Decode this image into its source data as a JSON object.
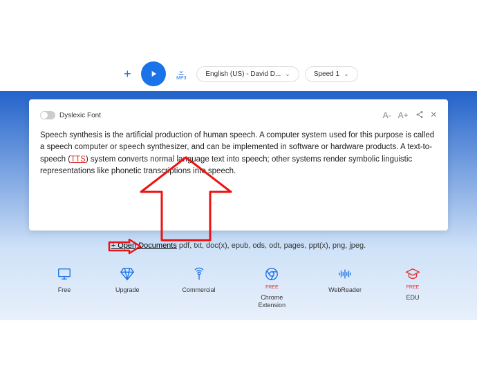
{
  "topbar": {
    "voice_selector": "English (US) - David D...",
    "speed_selector": "Speed 1",
    "mp3_label": "MP3"
  },
  "card": {
    "font_toggle_label": "Dyslexic Font",
    "font_dec": "A-",
    "font_inc": "A+",
    "share_label": "Share",
    "close_label": "×",
    "paragraph_pre": "Speech synthesis is the artificial production of human speech. A computer system used for this purpose is called a speech computer or speech synthesizer, and can be implemented in software or hardware products. A text-to-speech (",
    "tts_link": "TTS",
    "paragraph_post": ") system converts normal language text into speech; other systems render symbolic linguistic representations like phonetic transcriptions into speech."
  },
  "open_docs": {
    "link_text": "+ Open Documents",
    "ext_text": " pdf, txt, doc(x), epub, ods, odt, pages, ppt(x), png, jpeg."
  },
  "bottom": {
    "items": [
      {
        "label": "Free"
      },
      {
        "label": "Upgrade"
      },
      {
        "label": "Commercial"
      },
      {
        "label": "Chrome\nExtension",
        "badge": "FREE"
      },
      {
        "label": "WebReader"
      },
      {
        "label": "EDU",
        "badge": "FREE"
      }
    ]
  }
}
